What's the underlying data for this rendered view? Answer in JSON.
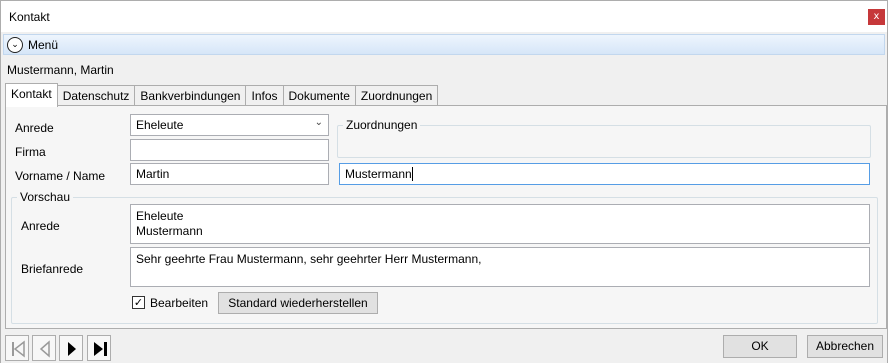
{
  "window": {
    "title": "Kontakt",
    "close_label": "x"
  },
  "menu": {
    "label": "Menü",
    "toggle_icon": "chevron-down-circle-icon"
  },
  "contact": {
    "display_name": "Mustermann, Martin"
  },
  "tabs": [
    {
      "label": "Kontakt",
      "active": true
    },
    {
      "label": "Datenschutz",
      "active": false
    },
    {
      "label": "Bankverbindungen",
      "active": false
    },
    {
      "label": "Infos",
      "active": false
    },
    {
      "label": "Dokumente",
      "active": false
    },
    {
      "label": "Zuordnungen",
      "active": false
    }
  ],
  "form": {
    "anrede_label": "Anrede",
    "anrede_value": "Eheleute",
    "firma_label": "Firma",
    "firma_value": "",
    "name_label": "Vorname / Name",
    "vorname_value": "Martin",
    "nachname_value": "Mustermann",
    "zuordnungen_title": "Zuordnungen"
  },
  "preview": {
    "title": "Vorschau",
    "anrede_label": "Anrede",
    "anrede_line1": "Eheleute",
    "anrede_line2": "Mustermann",
    "briefanrede_label": "Briefanrede",
    "briefanrede_value": "Sehr geehrte Frau Mustermann, sehr geehrter Herr Mustermann,",
    "edit_checkbox_label": "Bearbeiten",
    "edit_checked": true,
    "restore_button": "Standard wiederherstellen"
  },
  "footer": {
    "ok_label": "OK",
    "cancel_label": "Abbrechen"
  },
  "colors": {
    "close_button": "#c6383a",
    "menu_bar": "#d6e6f8",
    "focus_border": "#569de5"
  }
}
